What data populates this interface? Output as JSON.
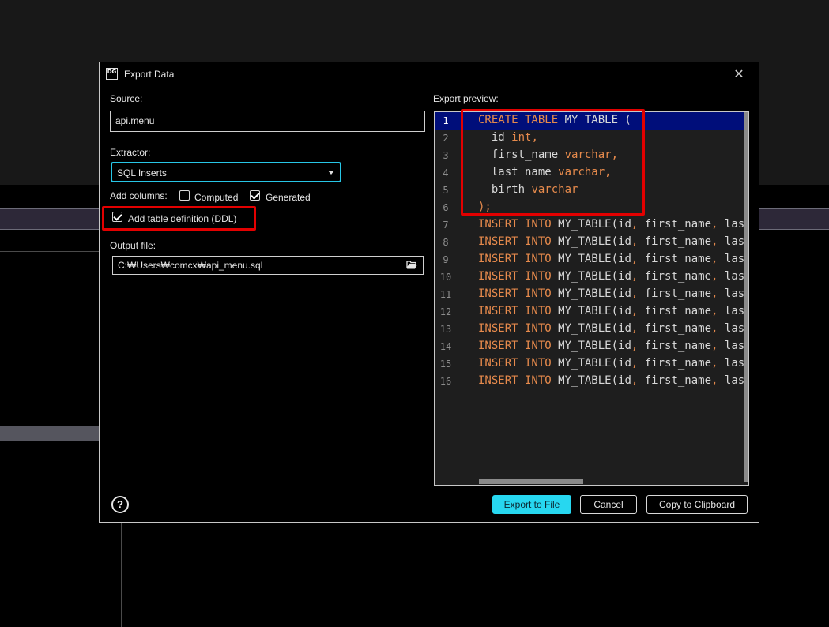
{
  "dialog": {
    "icon_text": "DG",
    "title": "Export Data",
    "close_label": "✕"
  },
  "source": {
    "label": "Source:",
    "value": "api.menu"
  },
  "extractor": {
    "label": "Extractor:",
    "selected": "SQL Inserts"
  },
  "add_columns": {
    "label": "Add columns:",
    "computed": {
      "label": "Computed",
      "checked": false
    },
    "generated": {
      "label": "Generated",
      "checked": true
    }
  },
  "ddl": {
    "label": "Add table definition (DDL)",
    "checked": true
  },
  "output": {
    "label": "Output file:",
    "value": "C:₩Users₩comcx₩api_menu.sql",
    "icon": "folder-open-icon"
  },
  "preview": {
    "label": "Export preview:",
    "lines": [
      {
        "n": "1",
        "tokens": [
          {
            "t": "CREATE TABLE ",
            "k": true
          },
          {
            "t": "MY_TABLE (",
            "k": false
          }
        ]
      },
      {
        "n": "2",
        "tokens": [
          {
            "t": "  id ",
            "k": false
          },
          {
            "t": "int,",
            "k": true
          }
        ]
      },
      {
        "n": "3",
        "tokens": [
          {
            "t": "  first_name ",
            "k": false
          },
          {
            "t": "varchar,",
            "k": true
          }
        ]
      },
      {
        "n": "4",
        "tokens": [
          {
            "t": "  last_name ",
            "k": false
          },
          {
            "t": "varchar,",
            "k": true
          }
        ]
      },
      {
        "n": "5",
        "tokens": [
          {
            "t": "  birth ",
            "k": false
          },
          {
            "t": "varchar",
            "k": true
          }
        ]
      },
      {
        "n": "6",
        "tokens": [
          {
            "t": ");",
            "k": true
          }
        ]
      },
      {
        "n": "7",
        "tokens": [
          {
            "t": "INSERT INTO ",
            "k": true
          },
          {
            "t": "MY_TABLE(id",
            "k": false
          },
          {
            "t": ", ",
            "k": true
          },
          {
            "t": "first_name",
            "k": false
          },
          {
            "t": ", ",
            "k": true
          },
          {
            "t": "last_n",
            "k": false
          }
        ]
      },
      {
        "n": "8",
        "tokens": [
          {
            "t": "INSERT INTO ",
            "k": true
          },
          {
            "t": "MY_TABLE(id",
            "k": false
          },
          {
            "t": ", ",
            "k": true
          },
          {
            "t": "first_name",
            "k": false
          },
          {
            "t": ", ",
            "k": true
          },
          {
            "t": "last_n",
            "k": false
          }
        ]
      },
      {
        "n": "9",
        "tokens": [
          {
            "t": "INSERT INTO ",
            "k": true
          },
          {
            "t": "MY_TABLE(id",
            "k": false
          },
          {
            "t": ", ",
            "k": true
          },
          {
            "t": "first_name",
            "k": false
          },
          {
            "t": ", ",
            "k": true
          },
          {
            "t": "last_n",
            "k": false
          }
        ]
      },
      {
        "n": "10",
        "tokens": [
          {
            "t": "INSERT INTO ",
            "k": true
          },
          {
            "t": "MY_TABLE(id",
            "k": false
          },
          {
            "t": ", ",
            "k": true
          },
          {
            "t": "first_name",
            "k": false
          },
          {
            "t": ", ",
            "k": true
          },
          {
            "t": "last_n",
            "k": false
          }
        ]
      },
      {
        "n": "11",
        "tokens": [
          {
            "t": "INSERT INTO ",
            "k": true
          },
          {
            "t": "MY_TABLE(id",
            "k": false
          },
          {
            "t": ", ",
            "k": true
          },
          {
            "t": "first_name",
            "k": false
          },
          {
            "t": ", ",
            "k": true
          },
          {
            "t": "last_n",
            "k": false
          }
        ]
      },
      {
        "n": "12",
        "tokens": [
          {
            "t": "INSERT INTO ",
            "k": true
          },
          {
            "t": "MY_TABLE(id",
            "k": false
          },
          {
            "t": ", ",
            "k": true
          },
          {
            "t": "first_name",
            "k": false
          },
          {
            "t": ", ",
            "k": true
          },
          {
            "t": "last_n",
            "k": false
          }
        ]
      },
      {
        "n": "13",
        "tokens": [
          {
            "t": "INSERT INTO ",
            "k": true
          },
          {
            "t": "MY_TABLE(id",
            "k": false
          },
          {
            "t": ", ",
            "k": true
          },
          {
            "t": "first_name",
            "k": false
          },
          {
            "t": ", ",
            "k": true
          },
          {
            "t": "last_n",
            "k": false
          }
        ]
      },
      {
        "n": "14",
        "tokens": [
          {
            "t": "INSERT INTO ",
            "k": true
          },
          {
            "t": "MY_TABLE(id",
            "k": false
          },
          {
            "t": ", ",
            "k": true
          },
          {
            "t": "first_name",
            "k": false
          },
          {
            "t": ", ",
            "k": true
          },
          {
            "t": "last_n",
            "k": false
          }
        ]
      },
      {
        "n": "15",
        "tokens": [
          {
            "t": "INSERT INTO ",
            "k": true
          },
          {
            "t": "MY_TABLE(id",
            "k": false
          },
          {
            "t": ", ",
            "k": true
          },
          {
            "t": "first_name",
            "k": false
          },
          {
            "t": ", ",
            "k": true
          },
          {
            "t": "last_n",
            "k": false
          }
        ]
      },
      {
        "n": "16",
        "tokens": [
          {
            "t": "INSERT INTO ",
            "k": true
          },
          {
            "t": "MY_TABLE(id",
            "k": false
          },
          {
            "t": ", ",
            "k": true
          },
          {
            "t": "first_name",
            "k": false
          },
          {
            "t": ", ",
            "k": true
          },
          {
            "t": "last_n",
            "k": false
          }
        ]
      }
    ]
  },
  "footer": {
    "help_label": "?",
    "export_label": "Export to File",
    "cancel_label": "Cancel",
    "copy_label": "Copy to Clipboard"
  },
  "colors": {
    "accent": "#27d7f0",
    "highlight": "#e30000",
    "keyword": "#e68a4c",
    "active_line": "#000e7a"
  }
}
